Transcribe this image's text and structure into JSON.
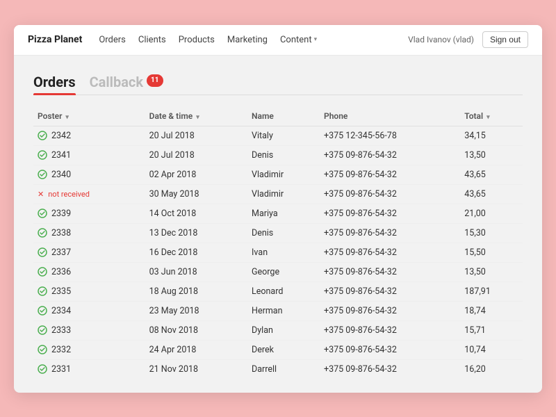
{
  "brand": "Pizza Planet",
  "nav": {
    "links": [
      {
        "label": "Orders",
        "has_dropdown": false
      },
      {
        "label": "Clients",
        "has_dropdown": false
      },
      {
        "label": "Products",
        "has_dropdown": false
      },
      {
        "label": "Marketing",
        "has_dropdown": false
      },
      {
        "label": "Content",
        "has_dropdown": true
      }
    ]
  },
  "user": {
    "name": "Vlad Ivanov (vlad)",
    "sign_out": "Sign out"
  },
  "tabs": [
    {
      "label": "Orders",
      "active": true
    },
    {
      "label": "Callback",
      "active": false,
      "badge": "11"
    }
  ],
  "table": {
    "columns": [
      {
        "label": "Poster",
        "sortable": true
      },
      {
        "label": "Date & time",
        "sortable": true
      },
      {
        "label": "Name",
        "sortable": false
      },
      {
        "label": "Phone",
        "sortable": false
      },
      {
        "label": "Total",
        "sortable": true
      }
    ],
    "rows": [
      {
        "id": "2342",
        "status": "ok",
        "date": "20 Jul 2018",
        "name": "Vitaly",
        "phone": "+375 12-345-56-78",
        "total": "34,15"
      },
      {
        "id": "2341",
        "status": "ok",
        "date": "20 Jul 2018",
        "name": "Denis",
        "phone": "+375 09-876-54-32",
        "total": "13,50"
      },
      {
        "id": "2340",
        "status": "ok",
        "date": "02 Apr 2018",
        "name": "Vladimir",
        "phone": "+375 09-876-54-32",
        "total": "43,65"
      },
      {
        "id": "not received",
        "status": "error",
        "date": "30 May 2018",
        "name": "Vladimir",
        "phone": "+375 09-876-54-32",
        "total": "43,65"
      },
      {
        "id": "2339",
        "status": "ok",
        "date": "14 Oct 2018",
        "name": "Mariya",
        "phone": "+375 09-876-54-32",
        "total": "21,00"
      },
      {
        "id": "2338",
        "status": "ok",
        "date": "13 Dec 2018",
        "name": "Denis",
        "phone": "+375 09-876-54-32",
        "total": "15,30"
      },
      {
        "id": "2337",
        "status": "ok",
        "date": "16 Dec 2018",
        "name": "Ivan",
        "phone": "+375 09-876-54-32",
        "total": "15,50"
      },
      {
        "id": "2336",
        "status": "ok",
        "date": "03 Jun 2018",
        "name": "George",
        "phone": "+375 09-876-54-32",
        "total": "13,50"
      },
      {
        "id": "2335",
        "status": "ok",
        "date": "18 Aug 2018",
        "name": "Leonard",
        "phone": "+375 09-876-54-32",
        "total": "187,91"
      },
      {
        "id": "2334",
        "status": "ok",
        "date": "23 May 2018",
        "name": "Herman",
        "phone": "+375 09-876-54-32",
        "total": "18,74"
      },
      {
        "id": "2333",
        "status": "ok",
        "date": "08 Nov 2018",
        "name": "Dylan",
        "phone": "+375 09-876-54-32",
        "total": "15,71"
      },
      {
        "id": "2332",
        "status": "ok",
        "date": "24 Apr 2018",
        "name": "Derek",
        "phone": "+375 09-876-54-32",
        "total": "10,74"
      },
      {
        "id": "2331",
        "status": "ok",
        "date": "21 Nov 2018",
        "name": "Darrell",
        "phone": "+375 09-876-54-32",
        "total": "16,20"
      }
    ]
  }
}
